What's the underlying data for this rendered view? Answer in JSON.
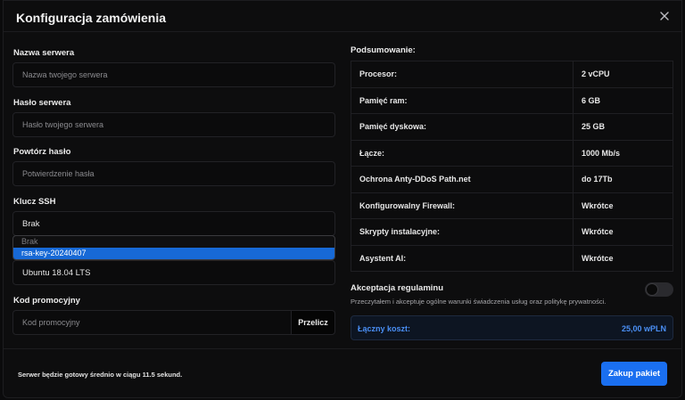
{
  "modal": {
    "title": "Konfiguracja zamówienia"
  },
  "form": {
    "server_name": {
      "label": "Nazwa serwera",
      "placeholder": "Nazwa twojego serwera"
    },
    "server_password": {
      "label": "Hasło serwera",
      "placeholder": "Hasło twojego serwera"
    },
    "repeat_password": {
      "label": "Powtórz hasło",
      "placeholder": "Potwierdzenie hasła"
    },
    "ssh_key": {
      "label": "Klucz SSH",
      "value": "Brak",
      "options": [
        "Brak",
        "rsa-key-20240407"
      ],
      "selected_index": 1
    },
    "os": {
      "value": "Ubuntu 18.04 LTS"
    },
    "promo": {
      "label": "Kod promocyjny",
      "placeholder": "Kod promocyjny",
      "button": "Przelicz"
    }
  },
  "summary": {
    "title": "Podsumowanie:",
    "rows": [
      {
        "k": "Procesor:",
        "v": "2 vCPU"
      },
      {
        "k": "Pamięć ram:",
        "v": "6 GB"
      },
      {
        "k": "Pamięć dyskowa:",
        "v": "25 GB"
      },
      {
        "k": "Łącze:",
        "v": "1000 Mb/s"
      },
      {
        "k": "Ochrona Anty-DDoS Path.net",
        "v": "do 17Tb"
      },
      {
        "k": "Konfigurowalny Firewall:",
        "v": "Wkrótce"
      },
      {
        "k": "Skrypty instalacyjne:",
        "v": "Wkrótce"
      },
      {
        "k": "Asystent AI:",
        "v": "Wkrótce"
      }
    ]
  },
  "terms": {
    "title": "Akceptacja regulaminu",
    "text": "Przeczytałem i akceptuje ogólne warunki świadczenia usług oraz politykę prywatności.",
    "accepted": false
  },
  "total": {
    "label": "Łączny koszt:",
    "value": "25,00 wPLN"
  },
  "footer": {
    "info": "Serwer będzie gotowy średnio w ciągu 11.5 sekund.",
    "buy_button": "Zakup pakiet"
  },
  "colors": {
    "accent": "#1a6ff0",
    "selected_option": "#1769d6"
  }
}
